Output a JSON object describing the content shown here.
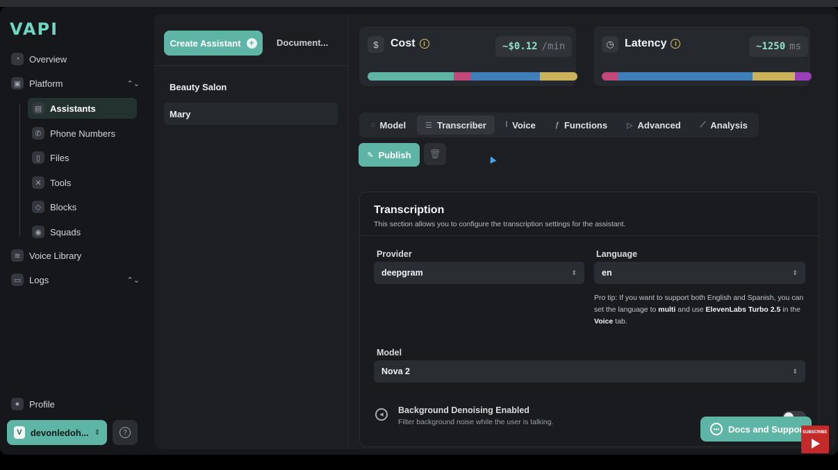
{
  "brand": {
    "logo": "VAPI"
  },
  "sidebar": {
    "overview": "Overview",
    "platform": "Platform",
    "items": [
      "Assistants",
      "Phone Numbers",
      "Files",
      "Tools",
      "Blocks",
      "Squads"
    ],
    "voice_library": "Voice Library",
    "logs": "Logs",
    "profile": "Profile",
    "user": "devonledoh...",
    "user_initial": "V",
    "help": "?"
  },
  "assistants_panel": {
    "create_label": "Create Assistant",
    "docs_tab": "Document...",
    "list": [
      "Beauty Salon",
      "Mary"
    ]
  },
  "metrics": {
    "cost": {
      "label": "Cost",
      "value": "~$0.12",
      "unit": "/min",
      "segments": [
        {
          "share": 0.41,
          "color": "#5fb5a5"
        },
        {
          "share": 0.08,
          "color": "#c0497a"
        },
        {
          "share": 0.33,
          "color": "#3f7fb8"
        },
        {
          "share": 0.18,
          "color": "#c9b25a"
        }
      ]
    },
    "latency": {
      "label": "Latency",
      "value": "~1250",
      "unit": "ms",
      "segments": [
        {
          "share": 0.08,
          "color": "#c0497a"
        },
        {
          "share": 0.64,
          "color": "#3f7fb8"
        },
        {
          "share": 0.2,
          "color": "#c9b25a"
        },
        {
          "share": 0.08,
          "color": "#9b3fb8"
        }
      ]
    }
  },
  "tabs": [
    "Model",
    "Transcriber",
    "Voice",
    "Functions",
    "Advanced",
    "Analysis"
  ],
  "active_tab": "Transcriber",
  "actions": {
    "publish": "Publish"
  },
  "transcription": {
    "title": "Transcription",
    "description": "This section allows you to configure the transcription settings for the assistant.",
    "provider_label": "Provider",
    "provider_value": "deepgram",
    "language_label": "Language",
    "language_value": "en",
    "tip_1": "Pro tip: If you want to support both English and Spanish, you can set the language to ",
    "tip_multi": "multi",
    "tip_2": " and use ",
    "tip_eleven": "ElevenLabs Turbo 2.5",
    "tip_3": " in the ",
    "tip_voice": "Voice",
    "tip_4": " tab.",
    "model_label": "Model",
    "model_value": "Nova 2",
    "denoise_title": "Background Denoising Enabled",
    "denoise_desc": "Filter background noise while the user is talking.",
    "denoise_on": false
  },
  "support": {
    "label": "Docs and Support"
  },
  "overlay": {
    "subscribe": "SUBSCRIBE"
  }
}
